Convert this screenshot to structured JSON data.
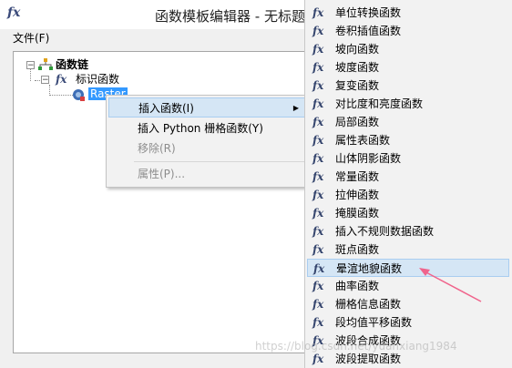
{
  "window": {
    "app_icon": "fx",
    "title": "函数模板编辑器 - 无标题"
  },
  "menubar": {
    "file": "文件(F)"
  },
  "tree": {
    "root": "函数链",
    "child": "标识函数",
    "leaf": "Raster"
  },
  "context_menu": {
    "items": [
      {
        "label": "插入函数(I)",
        "has_submenu": true,
        "highlighted": true,
        "enabled": true
      },
      {
        "label": "插入 Python 栅格函数(Y)",
        "enabled": true
      },
      {
        "label": "移除(R)",
        "enabled": false
      },
      {
        "label": "属性(P)...",
        "enabled": false
      }
    ]
  },
  "function_menu": {
    "items": [
      "单位转换函数",
      "卷积插值函数",
      "坡向函数",
      "坡度函数",
      "复变函数",
      "对比度和亮度函数",
      "局部函数",
      "属性表函数",
      "山体阴影函数",
      "常量函数",
      "拉伸函数",
      "掩膜函数",
      "插入不规则数据函数",
      "斑点函数",
      "晕渲地貌函数",
      "曲率函数",
      "栅格信息函数",
      "段均值平移函数",
      "波段合成函数",
      "波段提取函数"
    ],
    "highlighted_index": 14
  },
  "annotation": {
    "arrow_color": "#f0648c"
  },
  "watermark": "https://blog.csdn.net/yuanxiang1984"
}
